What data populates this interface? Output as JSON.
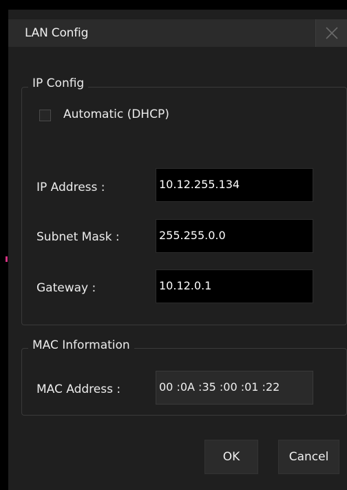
{
  "dialog": {
    "title": "LAN Config",
    "close_icon": "close-icon"
  },
  "ip_config": {
    "legend": "IP Config",
    "dhcp_label": "Automatic (DHCP)",
    "dhcp_checked": false,
    "ip_label": "IP Address :",
    "ip_value": "10.12.255.134",
    "mask_label": "Subnet Mask :",
    "mask_value": "255.255.0.0",
    "gateway_label": "Gateway :",
    "gateway_value": "10.12.0.1"
  },
  "mac_info": {
    "legend": "MAC Information",
    "mac_label": "MAC Address :",
    "mac_value": "00 :0A :35 :00 :01 :22"
  },
  "buttons": {
    "ok": "OK",
    "cancel": "Cancel"
  }
}
